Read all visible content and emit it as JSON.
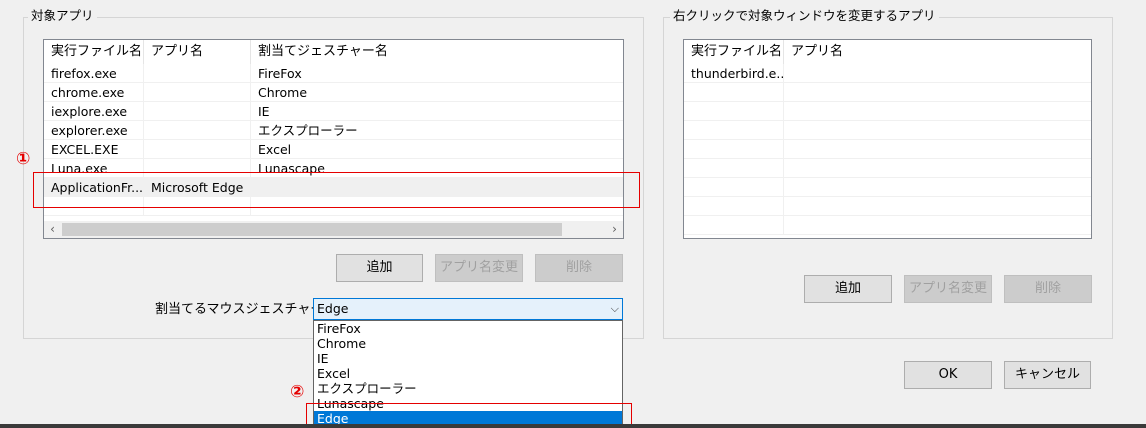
{
  "left_group": {
    "title": "対象アプリ",
    "columns": [
      "実行ファイル名",
      "アプリ名",
      "割当てジェスチャー名"
    ],
    "rows": [
      [
        "firefox.exe",
        "",
        "FireFox"
      ],
      [
        "chrome.exe",
        "",
        "Chrome"
      ],
      [
        "iexplore.exe",
        "",
        "IE"
      ],
      [
        "explorer.exe",
        "",
        "エクスプローラー"
      ],
      [
        "EXCEL.EXE",
        "",
        "Excel"
      ],
      [
        "Luna.exe",
        "",
        "Lunascape"
      ],
      [
        "ApplicationFr...",
        "Microsoft Edge",
        ""
      ]
    ],
    "buttons": {
      "add": "追加",
      "rename": "アプリ名変更",
      "delete": "削除"
    },
    "gesture_label": "割当てるマウスジェスチャー",
    "gesture_combo": {
      "selected": "Edge",
      "options": [
        "FireFox",
        "Chrome",
        "IE",
        "Excel",
        "エクスプローラー",
        "Lunascape",
        "Edge"
      ]
    }
  },
  "right_group": {
    "title": "右クリックで対象ウィンドウを変更するアプリ",
    "columns": [
      "実行ファイル名",
      "アプリ名"
    ],
    "rows": [
      [
        "thunderbird.e...",
        ""
      ]
    ],
    "buttons": {
      "add": "追加",
      "rename": "アプリ名変更",
      "delete": "削除"
    }
  },
  "dialog_buttons": {
    "ok": "OK",
    "cancel": "キャンセル"
  },
  "annotations": {
    "marker_1": "①",
    "marker_2": "②",
    "color": "#e50000"
  },
  "icons": {
    "scroll_left": "chevron-left-icon",
    "scroll_right": "chevron-right-icon",
    "combo_arrow": "chevron-down-icon"
  }
}
